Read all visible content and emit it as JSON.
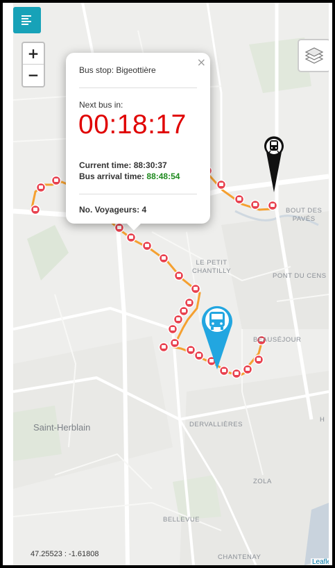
{
  "controls": {
    "zoom_in": "+",
    "zoom_out": "−"
  },
  "popup": {
    "bus_stop": "Bus stop: Bigeottière",
    "close": "×",
    "next_bus_label": "Next bus in:",
    "countdown": "00:18:17",
    "current_time_label": "Current time:",
    "current_time": "88:30:37",
    "arrival_label": "Bus arrival time:",
    "arrival_time": "88:48:54",
    "voyageurs": "No. Voyageurs: 4"
  },
  "map_labels": {
    "bout_des_paves_1": "BOUT DES",
    "bout_des_paves_2": "PAVÉS",
    "le_petit_chantilly_1": "LE PETIT",
    "le_petit_chantilly_2": "CHANTILLY",
    "pont_du_cens": "PONT DU CENS",
    "beausejour": "BEAUSÉJOUR",
    "saint_herblain": "Saint-Herblain",
    "dervallieres": "DERVALLIÈRES",
    "zola": "ZOLA",
    "bellevue": "BELLEVUE",
    "chantenay": "CHANTENAY",
    "h_edge": "H"
  },
  "footer": {
    "coordinates": "47.25523 : -1.61808",
    "attribution": "Leaflet"
  },
  "colors": {
    "route": "#f5a030",
    "stop": "#e8414f",
    "menu": "#17a2b8",
    "bus_marker": "#22a6e0",
    "countdown": "#e00000",
    "arrival": "#1e8a1e"
  },
  "icons": {
    "menu": "hamburger-icon",
    "layers": "layers-icon",
    "stop": "bus-stop-icon",
    "bus": "bus-icon",
    "train": "train-icon"
  }
}
